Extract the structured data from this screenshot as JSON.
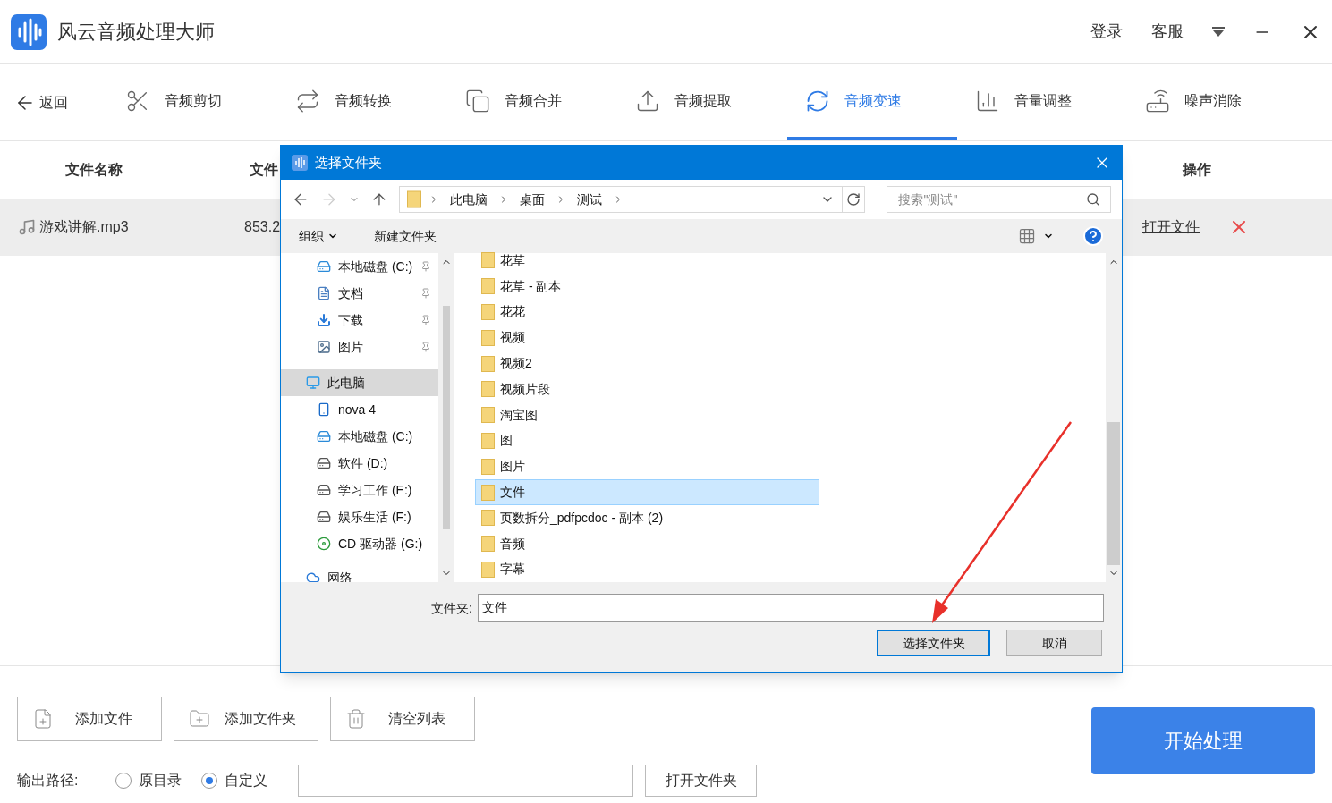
{
  "app": {
    "title": "风云音频处理大师",
    "header_links": [
      "登录",
      "客服"
    ]
  },
  "toolbar": {
    "back": "返回",
    "tabs": [
      {
        "label": "音频剪切",
        "kind": "cut",
        "selected": false
      },
      {
        "label": "音频转换",
        "kind": "convert",
        "selected": false
      },
      {
        "label": "音频合并",
        "kind": "merge",
        "selected": false
      },
      {
        "label": "音频提取",
        "kind": "extract",
        "selected": false
      },
      {
        "label": "音频变速",
        "kind": "speed",
        "selected": true
      },
      {
        "label": "音量调整",
        "kind": "volume",
        "selected": false
      },
      {
        "label": "噪声消除",
        "kind": "noise",
        "selected": false
      }
    ]
  },
  "table": {
    "columns": [
      "文件名称",
      "文件",
      "操作"
    ],
    "rows": [
      {
        "name": "游戏讲解.mp3",
        "column_2": "853.2",
        "action": "打开文件"
      }
    ]
  },
  "bottom": {
    "buttons": [
      {
        "label": "添加文件",
        "kind": "file"
      },
      {
        "label": "添加文件夹",
        "kind": "folder"
      },
      {
        "label": "清空列表",
        "kind": "trash"
      }
    ],
    "output_label": "输出路径:",
    "options": [
      {
        "label": "原目录",
        "selected": false
      },
      {
        "label": "自定义",
        "selected": true
      }
    ],
    "open_folder": "打开文件夹",
    "start": "开始处理"
  },
  "dialog": {
    "title": "选择文件夹",
    "path": [
      "此电脑",
      "桌面",
      "测试"
    ],
    "search_placeholder": "搜索\"测试\"",
    "organize": "组织",
    "new_folder": "新建文件夹",
    "quick_access": [
      {
        "label": "本地磁盘 (C:)",
        "kind": "drive_win"
      },
      {
        "label": "文档",
        "kind": "doc"
      },
      {
        "label": "下载",
        "kind": "download"
      },
      {
        "label": "图片",
        "kind": "picture"
      }
    ],
    "tree": [
      {
        "label": "此电脑",
        "kind": "pc",
        "selected": true,
        "children": [
          {
            "label": "nova 4",
            "kind": "phone",
            "selected": false
          },
          {
            "label": "本地磁盘 (C:)",
            "kind": "drive_win",
            "selected": false
          },
          {
            "label": "软件 (D:)",
            "kind": "drive",
            "selected": false
          },
          {
            "label": "学习工作 (E:)",
            "kind": "drive",
            "selected": false
          },
          {
            "label": "娱乐生活 (F:)",
            "kind": "drive",
            "selected": false
          },
          {
            "label": "CD 驱动器 (G:)",
            "kind": "cd",
            "selected": false
          }
        ]
      },
      {
        "label": "网络",
        "kind": "network",
        "selected": false
      }
    ],
    "folders": [
      {
        "name": "花草",
        "selected": false
      },
      {
        "name": "花草 - 副本",
        "selected": false
      },
      {
        "name": "花花",
        "selected": false
      },
      {
        "name": "视频",
        "selected": false
      },
      {
        "name": "视频2",
        "selected": false
      },
      {
        "name": "视频片段",
        "selected": false
      },
      {
        "name": "淘宝图",
        "selected": false
      },
      {
        "name": "图",
        "selected": false
      },
      {
        "name": "图片",
        "selected": false
      },
      {
        "name": "文件",
        "selected": true
      },
      {
        "name": "页数拆分_pdfpcdoc - 副本 (2)",
        "selected": false
      },
      {
        "name": "音频",
        "selected": false
      },
      {
        "name": "字幕",
        "selected": false
      }
    ],
    "folder_label": "文件夹:",
    "folder_value": "文件",
    "ok": "选择文件夹",
    "cancel": "取消"
  }
}
